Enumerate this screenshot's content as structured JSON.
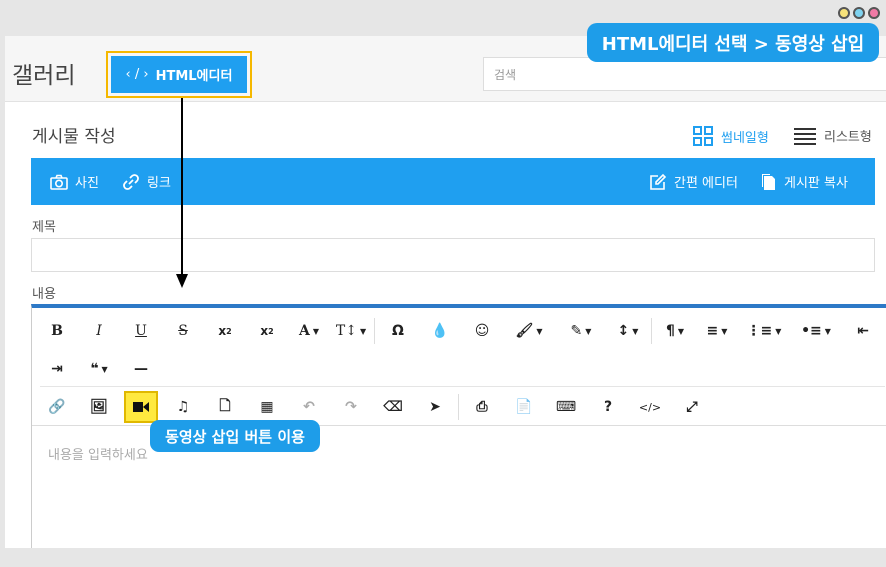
{
  "callout_top": "HTML에디터 선택 > 동영상 삽입",
  "callout_video": "동영상 삽입 버튼 이용",
  "header": {
    "title": "갤러리",
    "html_button": "HTML에디터",
    "search_placeholder": "검색"
  },
  "post": {
    "title": "게시물 작성",
    "view_thumb": "썸네일형",
    "view_list": "리스트형"
  },
  "bluebar": {
    "photo": "사진",
    "link": "링크",
    "simple_editor": "간편 에디터",
    "copy_board": "게시판 복사"
  },
  "form": {
    "subject_label": "제목",
    "content_label": "내용",
    "content_placeholder": "내용을 입력하세요"
  },
  "colors": {
    "accent": "#1f9ff0",
    "editor_border": "#2d79c7",
    "highlight": "#ffe93f"
  }
}
